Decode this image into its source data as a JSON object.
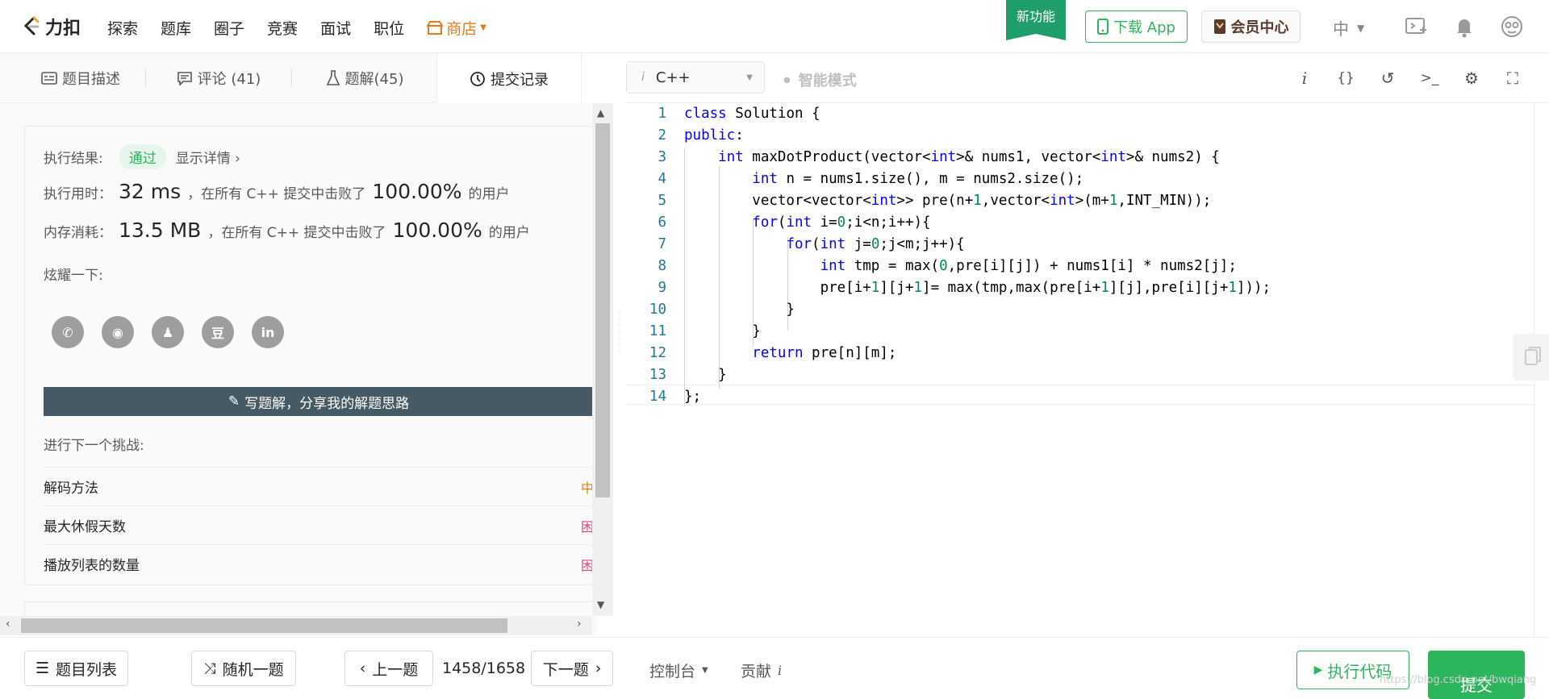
{
  "header": {
    "logo_text": "力扣",
    "nav": [
      "探索",
      "题库",
      "圈子",
      "竞赛",
      "面试",
      "职位"
    ],
    "shop": "商店",
    "new_feature": "新功能",
    "download_app": "下载 App",
    "vip": "会员中心",
    "lang": "中"
  },
  "tabs": [
    {
      "label": "题目描述"
    },
    {
      "label": "评论 (41)"
    },
    {
      "label": "题解(45)"
    },
    {
      "label": "提交记录"
    }
  ],
  "result": {
    "label": "执行结果:",
    "status": "通过",
    "details": "显示详情 ›",
    "time_label": "执行用时：",
    "time_value": "32 ms",
    "time_mid": "，在所有 C++ 提交中击败了",
    "time_pct": "100.00%",
    "users": "的用户",
    "mem_label": "内存消耗：",
    "mem_value": "13.5 MB",
    "mem_mid": "，在所有 C++ 提交中击败了",
    "mem_pct": "100.00%",
    "share_label": "炫耀一下:",
    "share_icons": [
      "wechat-icon",
      "weibo-icon",
      "qq-icon",
      "douban-icon",
      "linkedin-icon"
    ],
    "write_solution": "写题解，分享我的解题思路",
    "next_challenge": "进行下一个挑战:",
    "challenges": [
      {
        "title": "解码方法",
        "level": "中",
        "color": "#e97a1b"
      },
      {
        "title": "最大休假天数",
        "level": "困",
        "color": "#e0407c"
      },
      {
        "title": "播放列表的数量",
        "level": "困",
        "color": "#e0407c"
      }
    ]
  },
  "editor": {
    "language": "C++",
    "smart_mode": "智能模式",
    "lines": [
      "class Solution {",
      "public:",
      "    int maxDotProduct(vector<int>& nums1, vector<int>& nums2) {",
      "        int n = nums1.size(), m = nums2.size();",
      "        vector<vector<int>> pre(n+1,vector<int>(m+1,INT_MIN));",
      "        for(int i=0;i<n;i++){",
      "            for(int j=0;j<m;j++){",
      "                int tmp = max(0,pre[i][j]) + nums1[i] * nums2[j];",
      "                pre[i+1][j+1]= max(tmp,max(pre[i+1][j],pre[i][j+1]));",
      "            }",
      "        }",
      "        return pre[n][m];",
      "    }",
      "};"
    ]
  },
  "footer": {
    "problem_list": "题目列表",
    "random": "随机一题",
    "prev": "上一题",
    "counter": "1458/1658",
    "next": "下一题",
    "console": "控制台",
    "contribute": "贡献",
    "run": "执行代码",
    "submit": "提交",
    "watermark": "https://blog.csdn.net/bwqiang"
  }
}
